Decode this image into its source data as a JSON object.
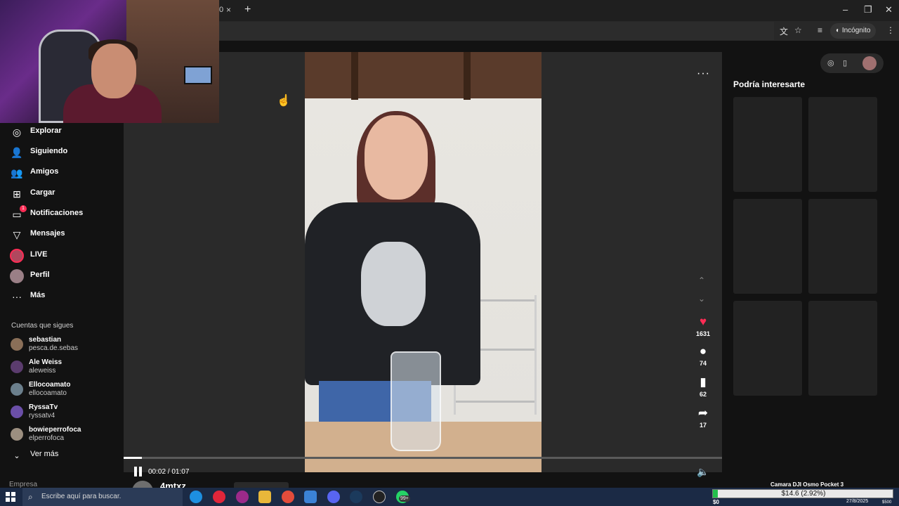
{
  "browser": {
    "tab_fragment": "0",
    "tab_close": "×",
    "new_tab": "+",
    "incognito_label": "Incógnito",
    "window_controls": [
      "–",
      "❐",
      "✕"
    ]
  },
  "sidebar": {
    "items": [
      {
        "label": "Explorar",
        "icon": "compass-icon"
      },
      {
        "label": "Siguiendo",
        "icon": "following-icon"
      },
      {
        "label": "Amigos",
        "icon": "friends-icon"
      },
      {
        "label": "Cargar",
        "icon": "upload-icon"
      },
      {
        "label": "Notificaciones",
        "icon": "inbox-icon",
        "badge": "1"
      },
      {
        "label": "Mensajes",
        "icon": "send-icon"
      },
      {
        "label": "LIVE",
        "icon": "live-avatar"
      },
      {
        "label": "Perfil",
        "icon": "profile-avatar"
      },
      {
        "label": "Más",
        "icon": "more-icon"
      }
    ],
    "following_title": "Cuentas que sigues",
    "accounts": [
      {
        "name": "sebastian",
        "handle": "pesca.de.sebas",
        "color": "#8a6f58"
      },
      {
        "name": "Ale Weiss",
        "handle": "aleweiss",
        "color": "#5b3c6e"
      },
      {
        "name": "Ellocoamato",
        "handle": "ellocoamato",
        "color": "#6b7f8c"
      },
      {
        "name": "RyssaTv",
        "handle": "ryssatv4",
        "color": "#6b4fa8"
      },
      {
        "name": "bowieperrofoca",
        "handle": "elperrofoca",
        "color": "#9c8f80"
      }
    ],
    "see_more": "Ver más",
    "footer": "Empresa"
  },
  "player": {
    "time": "00:02 / 01:07",
    "progress": 0.03,
    "more": "···",
    "actions": [
      {
        "name": "like",
        "icon": "♥",
        "count": "1631",
        "color": "#fe2c55"
      },
      {
        "name": "comment",
        "icon": "●",
        "count": "74",
        "color": "#ffffff"
      },
      {
        "name": "save",
        "icon": "▮",
        "count": "62",
        "color": "#ffffff"
      },
      {
        "name": "share",
        "icon": "➦",
        "count": "17",
        "color": "#ffffff"
      }
    ],
    "up_arrow": "⌃",
    "down_arrow": "⌄",
    "volume": "🔈"
  },
  "below": {
    "author": "4mtxz"
  },
  "right_panel": {
    "title": "Podría interesarte"
  },
  "taskbar": {
    "search_placeholder": "Escribe aquí para buscar.",
    "badge": "99+",
    "overlay_title": "Camara DJI Osmo Pocket 3",
    "goal_text": "$14.6 (2.92%)",
    "goal_progress": 0.0292,
    "goal_min": "$0",
    "goal_max": "$500",
    "date": "27/8/2025"
  }
}
